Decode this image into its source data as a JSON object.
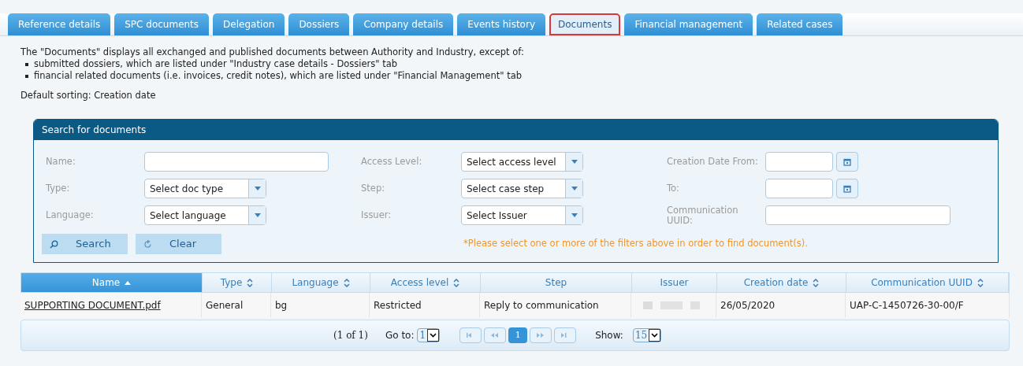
{
  "tabs": [
    {
      "label": "Reference details",
      "selected": false
    },
    {
      "label": "SPC documents",
      "selected": false
    },
    {
      "label": "Delegation",
      "selected": false
    },
    {
      "label": "Dossiers",
      "selected": false
    },
    {
      "label": "Company details",
      "selected": false
    },
    {
      "label": "Events history",
      "selected": false
    },
    {
      "label": "Documents",
      "selected": true
    },
    {
      "label": "Financial management",
      "selected": false
    },
    {
      "label": "Related cases",
      "selected": false
    }
  ],
  "intro": {
    "text": "The \"Documents\" displays all exchanged and published documents between Authority and Industry, except of:",
    "bullets": [
      "submitted dossiers, which are listed under \"Industry case details - Dossiers\" tab",
      "financial related documents (i.e. invoices, credit notes), which are listed under \"Financial Management\" tab"
    ],
    "sorting": "Default sorting: Creation date"
  },
  "search_panel": {
    "title": "Search for documents",
    "columns": [
      [
        {
          "kind": "text",
          "label": "Name:"
        },
        {
          "kind": "select",
          "label": "Type:",
          "value": "Select doc type"
        },
        {
          "kind": "select",
          "label": "Language:",
          "value": "Select language"
        }
      ],
      [
        {
          "kind": "select",
          "label": "Access Level:",
          "value": "Select access level"
        },
        {
          "kind": "select",
          "label": "Step:",
          "value": "Select case step"
        },
        {
          "kind": "select",
          "label": "Issuer:",
          "value": "Select Issuer"
        }
      ],
      [
        {
          "kind": "date",
          "label": "Creation Date From:"
        },
        {
          "kind": "date",
          "label": "To:"
        },
        {
          "kind": "wide",
          "label": "Communication UUID:"
        }
      ]
    ],
    "buttons": [
      {
        "kind": "search",
        "label": "Search"
      },
      {
        "kind": "clear",
        "label": "Clear"
      }
    ],
    "hint": "*Please select one or more of the filters above in order to find document(s)."
  },
  "table": {
    "columns": [
      {
        "label": "Name",
        "sortable": true,
        "selected": true
      },
      {
        "label": "Type",
        "sortable": true,
        "selected": false
      },
      {
        "label": "Language",
        "sortable": true,
        "selected": false
      },
      {
        "label": "Access level",
        "sortable": true,
        "selected": false
      },
      {
        "label": "Step",
        "sortable": false,
        "selected": false
      },
      {
        "label": "Issuer",
        "sortable": false,
        "selected": false
      },
      {
        "label": "Creation date",
        "sortable": true,
        "selected": false
      },
      {
        "label": "Communication UUID",
        "sortable": true,
        "selected": false
      }
    ],
    "rows": [
      {
        "cells": [
          {
            "kind": "link",
            "text": "SUPPORTING DOCUMENT.pdf"
          },
          {
            "kind": "text",
            "text": "General"
          },
          {
            "kind": "text",
            "text": "bg"
          },
          {
            "kind": "text",
            "text": "Restricted"
          },
          {
            "kind": "text",
            "text": "Reply to communication"
          },
          {
            "kind": "redacted"
          },
          {
            "kind": "text",
            "text": "26/05/2020"
          },
          {
            "kind": "text",
            "text": "UAP-C-1450726-30-00/F"
          }
        ]
      }
    ]
  },
  "pager": {
    "summary": "(1 of 1)",
    "goto_label": "Go to:",
    "goto_value": "1",
    "pages": [
      {
        "label": "1",
        "selected": true
      }
    ],
    "show_label": "Show:",
    "show_value": "15"
  }
}
